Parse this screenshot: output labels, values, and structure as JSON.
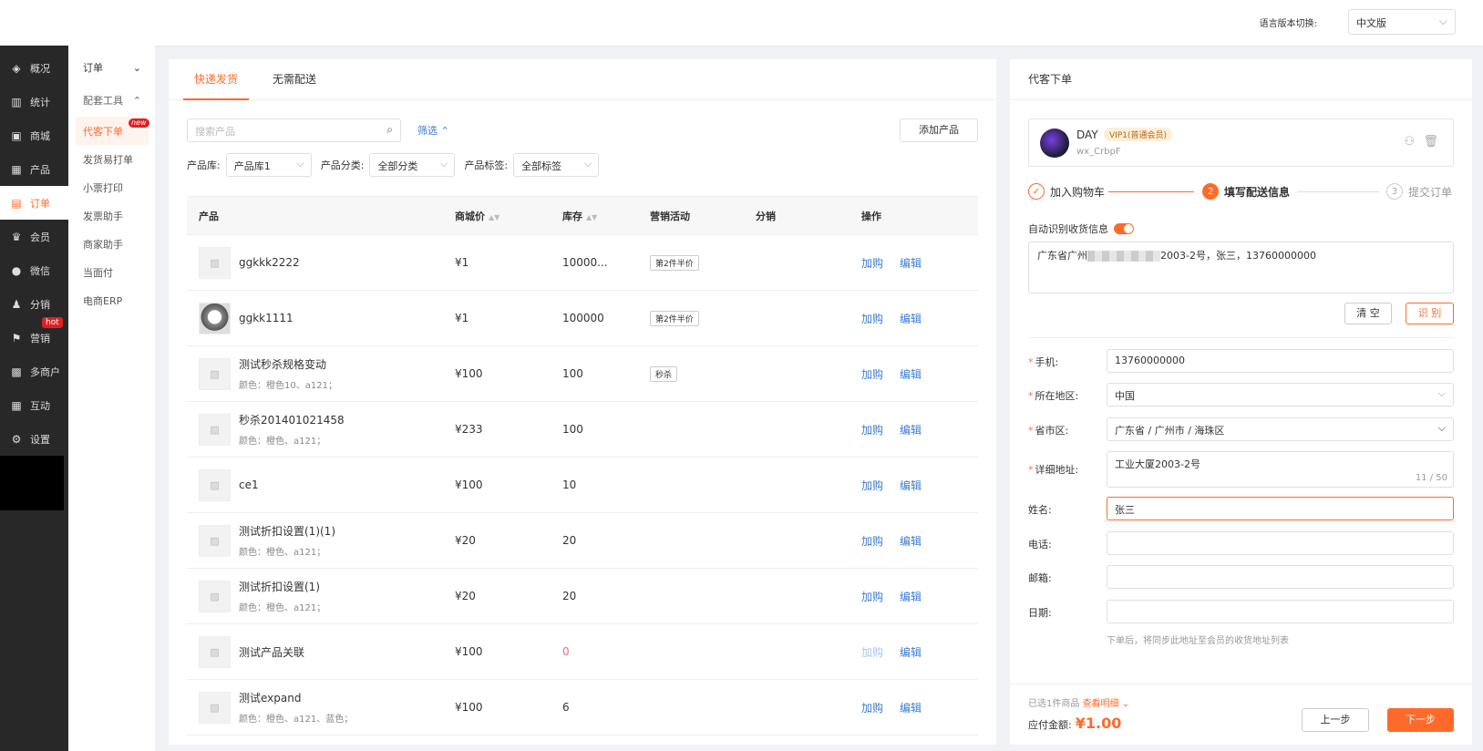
{
  "header": {
    "lang_label": "语言版本切换:",
    "lang_value": "中文版"
  },
  "sidebar": {
    "items": [
      {
        "label": "概况",
        "icon": "layers-icon"
      },
      {
        "label": "统计",
        "icon": "chart-icon"
      },
      {
        "label": "商城",
        "icon": "shop-icon"
      },
      {
        "label": "产品",
        "icon": "grid-icon"
      },
      {
        "label": "订单",
        "icon": "order-icon"
      },
      {
        "label": "会员",
        "icon": "crown-icon"
      },
      {
        "label": "微信",
        "icon": "wechat-icon"
      },
      {
        "label": "分销",
        "icon": "distribution-icon"
      },
      {
        "label": "营销",
        "icon": "flag-icon",
        "badge": "hot"
      },
      {
        "label": "多商户",
        "icon": "merchant-icon"
      },
      {
        "label": "互动",
        "icon": "interact-icon"
      },
      {
        "label": "设置",
        "icon": "gear-icon"
      }
    ]
  },
  "subnav": {
    "group1": "订单",
    "group2": "配套工具",
    "items": [
      "代客下单",
      "发货易打单",
      "小票打印",
      "发票助手",
      "商家助手",
      "当面付",
      "电商ERP"
    ],
    "new_badge": "new"
  },
  "main": {
    "tabs": [
      "快递发货",
      "无需配送"
    ],
    "search_placeholder": "搜索产品",
    "filter_label": "筛选",
    "add_product": "添加产品",
    "filters": {
      "lib_label": "产品库:",
      "lib_value": "产品库1",
      "cat_label": "产品分类:",
      "cat_value": "全部分类",
      "tag_label": "产品标签:",
      "tag_value": "全部标签"
    },
    "columns": [
      "产品",
      "商城价",
      "库存",
      "营销活动",
      "分销",
      "操作"
    ],
    "buy_label": "加购",
    "edit_label": "编辑",
    "rows": [
      {
        "name": "ggkkk2222",
        "spec": "",
        "price": "¥1",
        "stock": "10000...",
        "activity": "第2件半价"
      },
      {
        "name": "ggkk1111",
        "spec": "",
        "price": "¥1",
        "stock": "100000",
        "activity": "第2件半价"
      },
      {
        "name": "测试秒杀规格变动",
        "spec": "颜色：橙色10、a121；",
        "price": "¥100",
        "stock": "100",
        "activity": "秒杀"
      },
      {
        "name": "秒杀201401021458",
        "spec": "颜色：橙色、a121；",
        "price": "¥233",
        "stock": "100",
        "activity": ""
      },
      {
        "name": "ce1",
        "spec": "",
        "price": "¥100",
        "stock": "10",
        "activity": ""
      },
      {
        "name": "测试折扣设置(1)(1)",
        "spec": "颜色：橙色、a121；",
        "price": "¥20",
        "stock": "20",
        "activity": ""
      },
      {
        "name": "测试折扣设置(1)",
        "spec": "颜色：橙色、a121；",
        "price": "¥20",
        "stock": "20",
        "activity": ""
      },
      {
        "name": "测试产品关联",
        "spec": "",
        "price": "¥100",
        "stock": "0",
        "activity": ""
      },
      {
        "name": "测试expand",
        "spec": "颜色：橙色、a121、蓝色；",
        "price": "¥100",
        "stock": "6",
        "activity": ""
      }
    ]
  },
  "order": {
    "title": "代客下单",
    "member": {
      "name": "DAY",
      "level": "VIP1(普通会员)",
      "id": "wx_CrbpF"
    },
    "steps": [
      "加入购物车",
      "填写配送信息",
      "提交订单"
    ],
    "step_nums": [
      "2",
      "3"
    ],
    "auto_label": "自动识别收货信息",
    "addr_prefix": "广东省广州",
    "addr_suffix": "2003-2号，张三，13760000000",
    "clear_btn": "清 空",
    "recog_btn": "识 别",
    "fields": {
      "phone_label": "手机:",
      "phone_value": "13760000000",
      "region_label": "所在地区:",
      "region_value": "中国",
      "pcd_label": "省市区:",
      "pcd_value": "广东省 / 广州市 / 海珠区",
      "addr_label": "详细地址:",
      "addr_value": "工业大厦2003-2号",
      "addr_count": "11 / 50",
      "name_label": "姓名:",
      "name_value": "张三",
      "tel_label": "电话:",
      "zip_label": "邮箱:",
      "date_label": "日期:"
    },
    "hint": "下单后，将同步此地址至会员的收货地址列表",
    "selected": "已选1件商品",
    "view_detail": "查看明细",
    "pay_label": "应付金额:",
    "pay_amount": "¥1.00",
    "prev": "上一步",
    "next": "下一步"
  }
}
